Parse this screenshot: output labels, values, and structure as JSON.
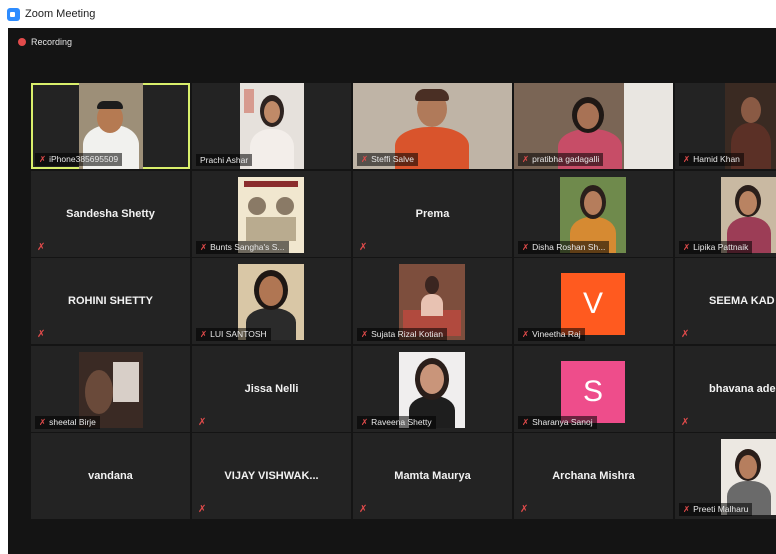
{
  "window": {
    "title": "Zoom Meeting"
  },
  "recording": {
    "label": "Recording"
  },
  "participants": [
    {
      "name": "iPhone385695509",
      "center": ""
    },
    {
      "name": "Prachi Ashar",
      "center": ""
    },
    {
      "name": "Steffi Salve",
      "center": ""
    },
    {
      "name": "pratibha gadagalli",
      "center": ""
    },
    {
      "name": "Hamid Khan",
      "center": ""
    },
    {
      "name": "",
      "center": "Sandesha Shetty"
    },
    {
      "name": "Bunts Sangha's S...",
      "center": ""
    },
    {
      "name": "",
      "center": "Prema"
    },
    {
      "name": "Disha Roshan Sh...",
      "center": ""
    },
    {
      "name": "Lipika Pattnaik",
      "center": ""
    },
    {
      "name": "",
      "center": "ROHINI SHETTY"
    },
    {
      "name": "LUI SANTOSH",
      "center": ""
    },
    {
      "name": "Sujata Rizal Kotian",
      "center": ""
    },
    {
      "name": "Vineetha Raj",
      "center": "",
      "avatar_letter": "V",
      "avatar_color": "#ff5a1f"
    },
    {
      "name": "",
      "center": "SEEMA KAD"
    },
    {
      "name": "sheetal Birje",
      "center": ""
    },
    {
      "name": "",
      "center": "Jissa Nelli"
    },
    {
      "name": "Raveena Shetty",
      "center": ""
    },
    {
      "name": "Sharanya Sanoj",
      "center": "",
      "avatar_letter": "S",
      "avatar_color": "#ee4d8b"
    },
    {
      "name": "",
      "center": "bhavana ade"
    },
    {
      "name": "",
      "center": "vandana"
    },
    {
      "name": "",
      "center": "VIJAY VISHWAK..."
    },
    {
      "name": "",
      "center": "Mamta Maurya"
    },
    {
      "name": "",
      "center": "Archana Mishra"
    },
    {
      "name": "Preeti Malharu",
      "center": ""
    }
  ]
}
